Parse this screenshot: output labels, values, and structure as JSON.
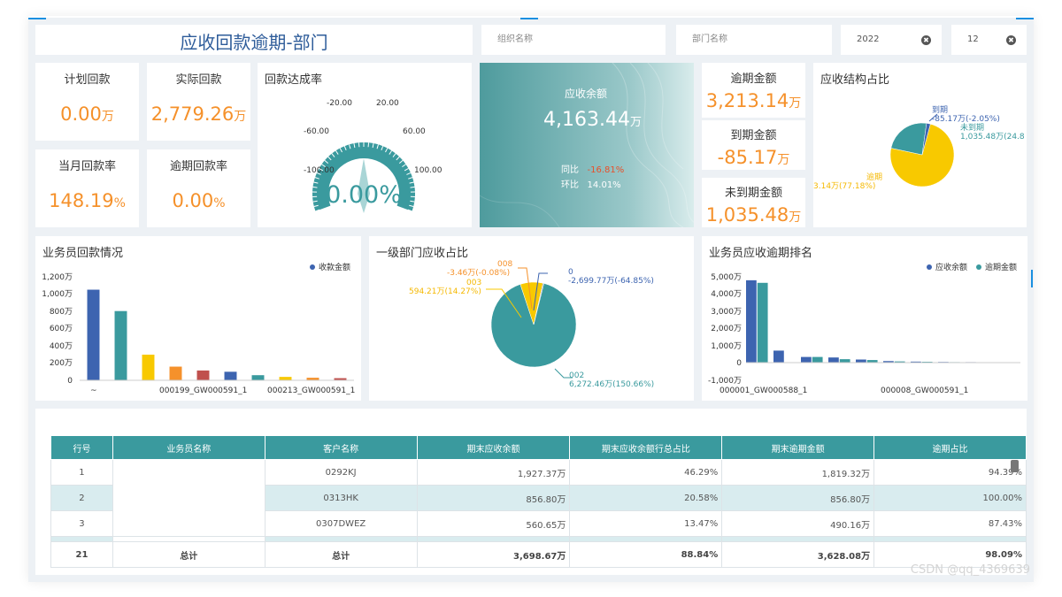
{
  "header": {
    "title": "应收回款逾期-部门"
  },
  "filters": {
    "org_placeholder": "组织名称",
    "dept_placeholder": "部门名称",
    "year": "2022",
    "month": "12",
    "clear_icon": "✖"
  },
  "kpis": {
    "plan": {
      "label": "计划回款",
      "value": "0.00",
      "unit": "万"
    },
    "actual": {
      "label": "实际回款",
      "value": "2,779.26",
      "unit": "万"
    },
    "month_rate": {
      "label": "当月回款率",
      "value": "148.19",
      "unit": "%"
    },
    "overdue_rate": {
      "label": "逾期回款率",
      "value": "0.00",
      "unit": "%"
    }
  },
  "gauge": {
    "title": "回款达成率",
    "value": "0.00%",
    "level": 0,
    "ticks": [
      "-100.00",
      "-60.00",
      "-20.00",
      "20.00",
      "60.00",
      "100.00"
    ]
  },
  "receivable": {
    "label": "应收余额",
    "value": "4,163.44",
    "unit": "万",
    "yoy_label": "同比",
    "yoy_value": "-16.81%",
    "mom_label": "环比",
    "mom_value": "14.01%"
  },
  "overdue": {
    "amount": {
      "label": "逾期金额",
      "value": "3,213.14",
      "unit": "万"
    },
    "due": {
      "label": "到期金额",
      "value": "-85.17",
      "unit": "万"
    },
    "not_due": {
      "label": "未到期金额",
      "value": "1,035.48",
      "unit": "万"
    }
  },
  "structure_pie": {
    "title": "应收结构占比",
    "labels": {
      "due": [
        "到期",
        "-85.17万(-2.05%)"
      ],
      "not_due": [
        "未到期",
        "1,035.48万(24.8"
      ],
      "overdue": [
        "逾期",
        "3.14万(77.18%)"
      ]
    }
  },
  "salesman_chart": {
    "title": "业务员回款情况",
    "legend": "收款金额",
    "y_ticks": [
      "1,200万",
      "1,000万",
      "800万",
      "600万",
      "400万",
      "200万",
      "0"
    ],
    "x_labels": [
      "~",
      "000199_GW000591_1",
      "000213_GW000591_1"
    ]
  },
  "dept_pie": {
    "title": "一级部门应收占比",
    "labels": {
      "d0": [
        "0",
        "-2,699.77万(-64.85%)"
      ],
      "d008": [
        "008",
        "-3.46万(-0.08%)"
      ],
      "d003": [
        "003",
        "594.21万(14.27%)"
      ],
      "d002": [
        "002",
        "6,272.46万(150.66%)"
      ]
    }
  },
  "rank_chart": {
    "title": "业务员应收逾期排名",
    "legend_a": "应收余额",
    "legend_b": "逾期金额",
    "y_ticks": [
      "5,000万",
      "4,000万",
      "3,000万",
      "2,000万",
      "1,000万",
      "0",
      "-1,000万"
    ],
    "x_labels": [
      "000001_GW000588_1",
      "000008_GW000591_1"
    ]
  },
  "table": {
    "headers": [
      "行号",
      "业务员名称",
      "客户名称",
      "期末应收余额",
      "期末应收余额行总占比",
      "期末逾期金额",
      "逾期占比"
    ],
    "rows": [
      [
        "1",
        "",
        "0292KJ",
        "1,927.37万",
        "46.29%",
        "1,819.32万",
        "94.39%"
      ],
      [
        "2",
        "",
        "0313HK",
        "856.80万",
        "20.58%",
        "856.80万",
        "100.00%"
      ],
      [
        "3",
        "",
        "0307DWEZ",
        "560.65万",
        "13.47%",
        "490.16万",
        "87.43%"
      ]
    ],
    "total": [
      "21",
      "总计",
      "总计",
      "3,698.67万",
      "88.84%",
      "3,628.08万",
      "98.09%"
    ]
  },
  "watermark": "CSDN @qq_4369639",
  "chart_data": [
    {
      "type": "bar",
      "title": "业务员回款情况",
      "series": [
        {
          "name": "收款金额",
          "values": [
            1060,
            810,
            300,
            160,
            115,
            100,
            60,
            40,
            30,
            25
          ]
        }
      ],
      "ylim": [
        0,
        1200
      ],
      "colors": [
        "#3d64b0",
        "#3a9a9e",
        "#f8c900",
        "#f5912b",
        "#c0504d",
        "#3d64b0",
        "#3a9a9e",
        "#f8c900",
        "#f5912b",
        "#c0504d"
      ]
    },
    {
      "type": "bar",
      "title": "业务员应收逾期排名",
      "series": [
        {
          "name": "应收余额",
          "values": [
            4800,
            700,
            330,
            300,
            180,
            90,
            60,
            40,
            30,
            20
          ]
        },
        {
          "name": "逾期金额",
          "values": [
            4650,
            0,
            330,
            200,
            150,
            70,
            50,
            30,
            20,
            10
          ]
        }
      ],
      "ylim": [
        -1000,
        5000
      ],
      "colors": [
        "#3d64b0",
        "#3a9a9e"
      ]
    },
    {
      "type": "pie",
      "title": "应收结构占比",
      "slices": [
        {
          "name": "逾期",
          "value": 77.18,
          "color": "#f8c900"
        },
        {
          "name": "未到期",
          "value": 24.8,
          "color": "#3a9a9e"
        },
        {
          "name": "到期",
          "value": 2.05,
          "color": "#3d64b0"
        }
      ]
    },
    {
      "type": "pie",
      "title": "一级部门应收占比",
      "slices": [
        {
          "name": "002",
          "value": 150.66,
          "color": "#3a9a9e"
        },
        {
          "name": "003",
          "value": 14.27,
          "color": "#f8c900"
        },
        {
          "name": "008",
          "value": 0.08,
          "color": "#f5912b"
        },
        {
          "name": "0",
          "value": 0.5,
          "color": "#3d64b0"
        }
      ]
    }
  ]
}
